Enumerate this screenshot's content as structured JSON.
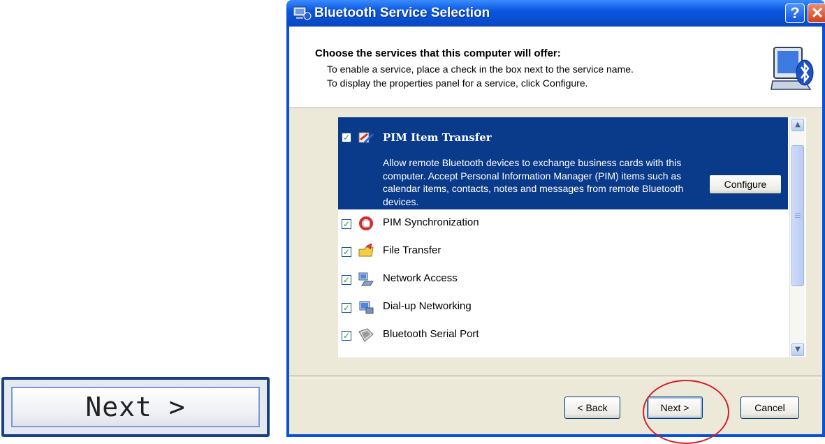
{
  "enlarged_button": {
    "label": "Next >"
  },
  "window": {
    "title": "Bluetooth Service Selection",
    "help_label": "?",
    "close_label": "✕"
  },
  "header": {
    "heading": "Choose the services that this computer will offer:",
    "line1": "To enable a service, place a check in the box next to the service name.",
    "line2": "To display the properties panel for a service, click Configure."
  },
  "services": {
    "selected": {
      "label": "PIM Item Transfer",
      "checked": true,
      "icon": "pim-transfer-icon",
      "description": "Allow remote Bluetooth devices to exchange business cards with this computer. Accept Personal Information Manager (PIM) items such as calendar items, contacts, notes and messages from remote Bluetooth devices.",
      "configure_label": "Configure"
    },
    "items": [
      {
        "label": "PIM Synchronization",
        "checked": true,
        "icon": "pim-sync-icon"
      },
      {
        "label": "File Transfer",
        "checked": true,
        "icon": "file-transfer-icon"
      },
      {
        "label": "Network Access",
        "checked": true,
        "icon": "network-access-icon"
      },
      {
        "label": "Dial-up Networking",
        "checked": true,
        "icon": "dialup-icon"
      },
      {
        "label": "Bluetooth Serial Port",
        "checked": true,
        "icon": "serial-port-icon"
      }
    ]
  },
  "buttons": {
    "back": "< Back",
    "next": "Next >",
    "cancel": "Cancel"
  },
  "annotation": {
    "color": "#d2202a",
    "shape": "ellipse around Next button"
  },
  "colors": {
    "title_bar": "#0a57e0",
    "selection": "#0a3a8a",
    "checkmark": "#21a121"
  }
}
